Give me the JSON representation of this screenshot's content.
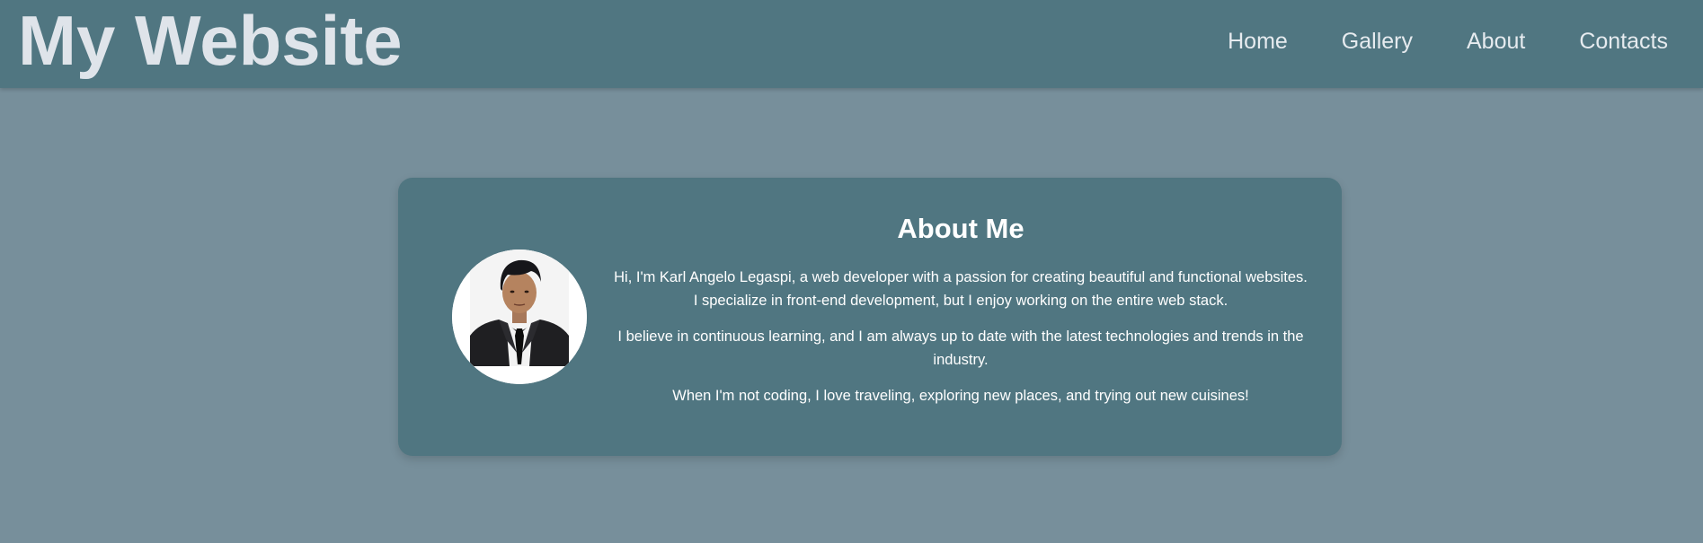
{
  "header": {
    "site_title": "My Website",
    "nav": [
      {
        "label": "Home"
      },
      {
        "label": "Gallery"
      },
      {
        "label": "About"
      },
      {
        "label": "Contacts"
      }
    ]
  },
  "about": {
    "title": "About Me",
    "paragraphs": [
      {
        "lines": [
          "Hi, I'm Karl Angelo Legaspi, a web developer with a passion for creating beautiful and functional websites.",
          "I specialize in front-end development, but I enjoy working on the entire web stack."
        ]
      },
      {
        "lines": [
          "I believe in continuous learning, and I am always up to date with the latest technologies and trends in the",
          "industry."
        ]
      },
      {
        "lines": [
          "When I'm not coding, I love traveling, exploring new places, and trying out new cuisines!"
        ]
      }
    ]
  },
  "colors": {
    "page_background": "#778f9b",
    "header_background": "#507681",
    "card_background": "#507681",
    "title_text": "#dfe4ea",
    "body_text": "#ffffff"
  }
}
